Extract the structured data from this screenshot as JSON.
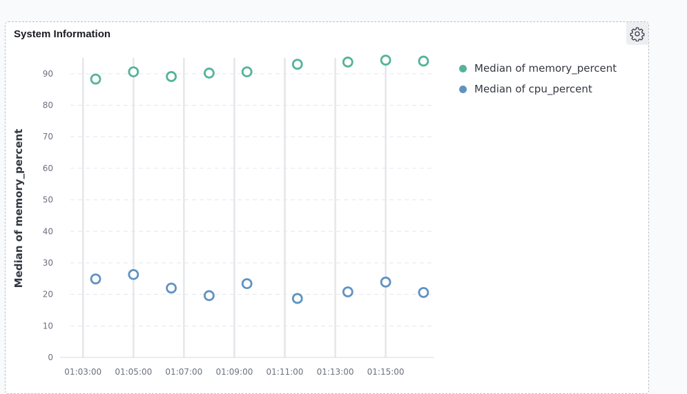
{
  "panel": {
    "title": "System Information",
    "settings_icon": "gear-icon"
  },
  "colors": {
    "memory": "#54b399",
    "cpu": "#6092c0",
    "grid": "#e4e6ea",
    "axis_text": "#69707d"
  },
  "chart_data": {
    "type": "scatter",
    "ylabel": "Median of memory_percent",
    "xlabel": "",
    "ylim": [
      0,
      95
    ],
    "yticks": [
      0,
      10,
      20,
      30,
      40,
      50,
      60,
      70,
      80,
      90
    ],
    "x_tick_labels": [
      "01:03:00",
      "01:05:00",
      "01:07:00",
      "01:09:00",
      "01:11:00",
      "01:13:00",
      "01:15:00"
    ],
    "x_tick_minutes": [
      63,
      65,
      67,
      69,
      71,
      73,
      75
    ],
    "x_range_minutes": [
      62.5,
      76.9
    ],
    "grid": "vertical-solid-horizontal-dashed",
    "legend_position": "right",
    "x": [
      "01:03:30",
      "01:05:00",
      "01:06:30",
      "01:08:00",
      "01:09:30",
      "01:11:30",
      "01:13:30",
      "01:15:00",
      "01:16:30"
    ],
    "series": [
      {
        "name": "Median of memory_percent",
        "color": "#54b399",
        "values": [
          88.3,
          90.6,
          89.1,
          90.2,
          90.6,
          93.0,
          93.7,
          94.3,
          94.0
        ]
      },
      {
        "name": "Median of cpu_percent",
        "color": "#6092c0",
        "values": [
          24.9,
          26.3,
          22.0,
          19.6,
          23.4,
          18.7,
          20.8,
          23.9,
          20.6
        ]
      }
    ]
  }
}
